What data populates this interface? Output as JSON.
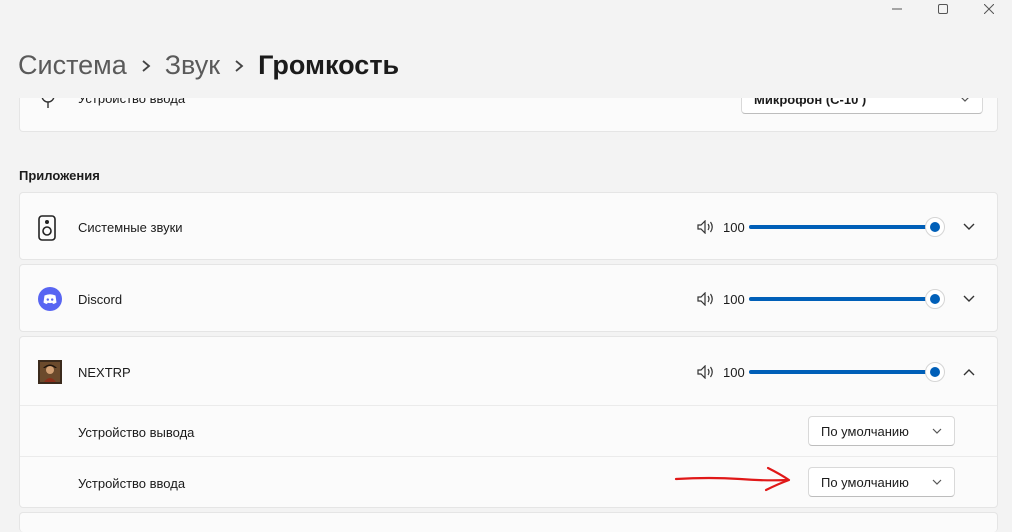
{
  "window": {
    "controls": [
      "minimize",
      "maximize",
      "close"
    ]
  },
  "breadcrumb": {
    "items": [
      "Система",
      "Звук",
      "Громкость"
    ]
  },
  "input_device_card": {
    "label": "Устройство ввода",
    "dropdown_value": "Микрофон (С-10 )"
  },
  "apps_section": {
    "title": "Приложения",
    "apps": [
      {
        "name": "Системные звуки",
        "volume": "100",
        "volume_fraction": 1.0,
        "icon": "speaker-device-icon",
        "expanded": false
      },
      {
        "name": "Discord",
        "volume": "100",
        "volume_fraction": 1.0,
        "icon": "discord-icon",
        "expanded": false
      },
      {
        "name": "NEXTRP",
        "volume": "100",
        "volume_fraction": 1.0,
        "icon": "nextrp-avatar-icon",
        "expanded": true
      }
    ],
    "nextrp_settings": {
      "output_label": "Устройство вывода",
      "output_value": "По умолчанию",
      "input_label": "Устройство ввода",
      "input_value": "По умолчанию"
    }
  },
  "colors": {
    "accent": "#005fb8",
    "annotation_arrow": "#e01818",
    "discord": "#5865f2"
  }
}
